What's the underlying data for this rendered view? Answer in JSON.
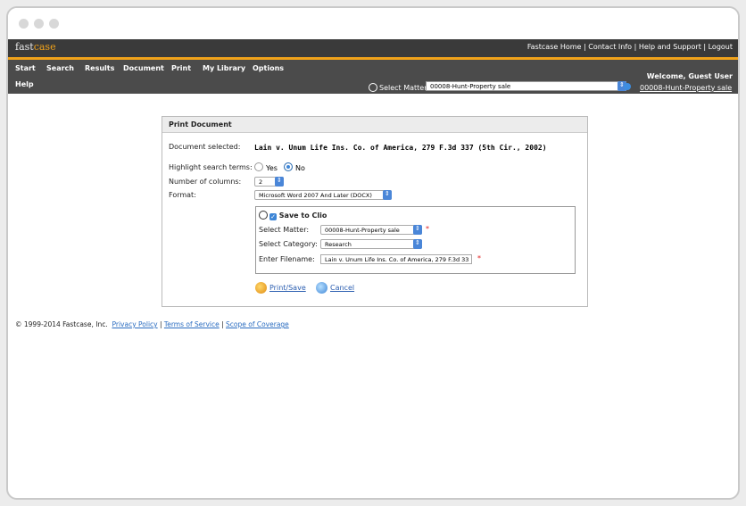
{
  "topbar": {
    "logo_prefix": "fast",
    "logo_suffix": "case",
    "links": [
      "Fastcase Home",
      "Contact Info",
      "Help and Support",
      "Logout"
    ]
  },
  "nav": {
    "items": [
      "Start",
      "Search",
      "Results",
      "Document",
      "Print",
      "My Library",
      "Options",
      "Help"
    ],
    "welcome": "Welcome, Guest User",
    "select_matter_label": "Select Matter:",
    "select_matter_value": "00008-Hunt-Property sale",
    "matter_link": "00008-Hunt-Property sale"
  },
  "panel": {
    "title": "Print Document",
    "doc_label": "Document selected:",
    "doc_value": "Lain v. Unum Life Ins. Co. of America, 279 F.3d 337 (5th Cir., 2002)",
    "highlight_label": "Highlight search terms:",
    "yes_label": "Yes",
    "no_label": "No",
    "columns_label": "Number of columns:",
    "columns_value": "2",
    "format_label": "Format:",
    "format_value": "Microsoft Word 2007 And Later (DOCX)",
    "save_label": "Save to Clio",
    "matter_label": "Select Matter:",
    "matter_value": "00008-Hunt-Property sale",
    "category_label": "Select Category:",
    "category_value": "Research",
    "filename_label": "Enter Filename:",
    "filename_value": "Lain v. Unum Life Ins. Co. of America, 279 F.3d 33",
    "required_mark": "*",
    "print_save": "Print/Save",
    "cancel": "Cancel"
  },
  "footer": {
    "copyright": "© 1999-2014 Fastcase, Inc.",
    "links": [
      "Privacy Policy",
      "Terms of Service",
      "Scope of Coverage"
    ]
  },
  "colors": {
    "accent": "#f0a21a",
    "nav_bg": "#4b4b4b",
    "topbar_bg": "#3a3a3a",
    "link": "#2a6cc0"
  }
}
